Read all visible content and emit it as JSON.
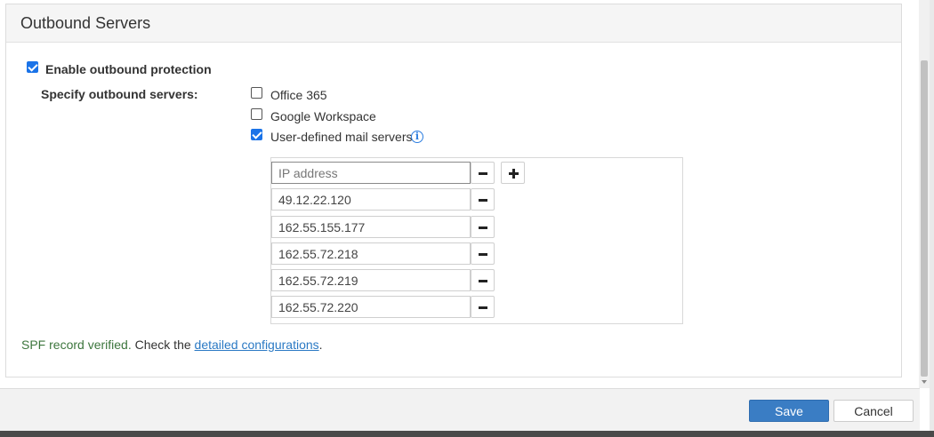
{
  "panel": {
    "title": "Outbound Servers"
  },
  "protection": {
    "label": "Enable outbound protection",
    "checked": true
  },
  "servers": {
    "label": "Specify outbound servers:",
    "options": [
      {
        "label": "Office 365",
        "checked": false
      },
      {
        "label": "Google Workspace",
        "checked": false
      },
      {
        "label": "User-defined mail servers",
        "checked": true
      }
    ]
  },
  "ip_list": {
    "placeholder": "IP address",
    "entries": [
      "49.12.22.120",
      "162.55.155.177",
      "162.55.72.218",
      "162.55.72.219",
      "162.55.72.220"
    ]
  },
  "spf": {
    "status": "SPF record verified.",
    "text": " Check the ",
    "link": "detailed configurations",
    "end": "."
  },
  "footer": {
    "save_label": "Save",
    "cancel_label": "Cancel"
  },
  "colors": {
    "accent": "#3a7dc4",
    "success": "#3c763d",
    "link": "#2a79c4"
  }
}
